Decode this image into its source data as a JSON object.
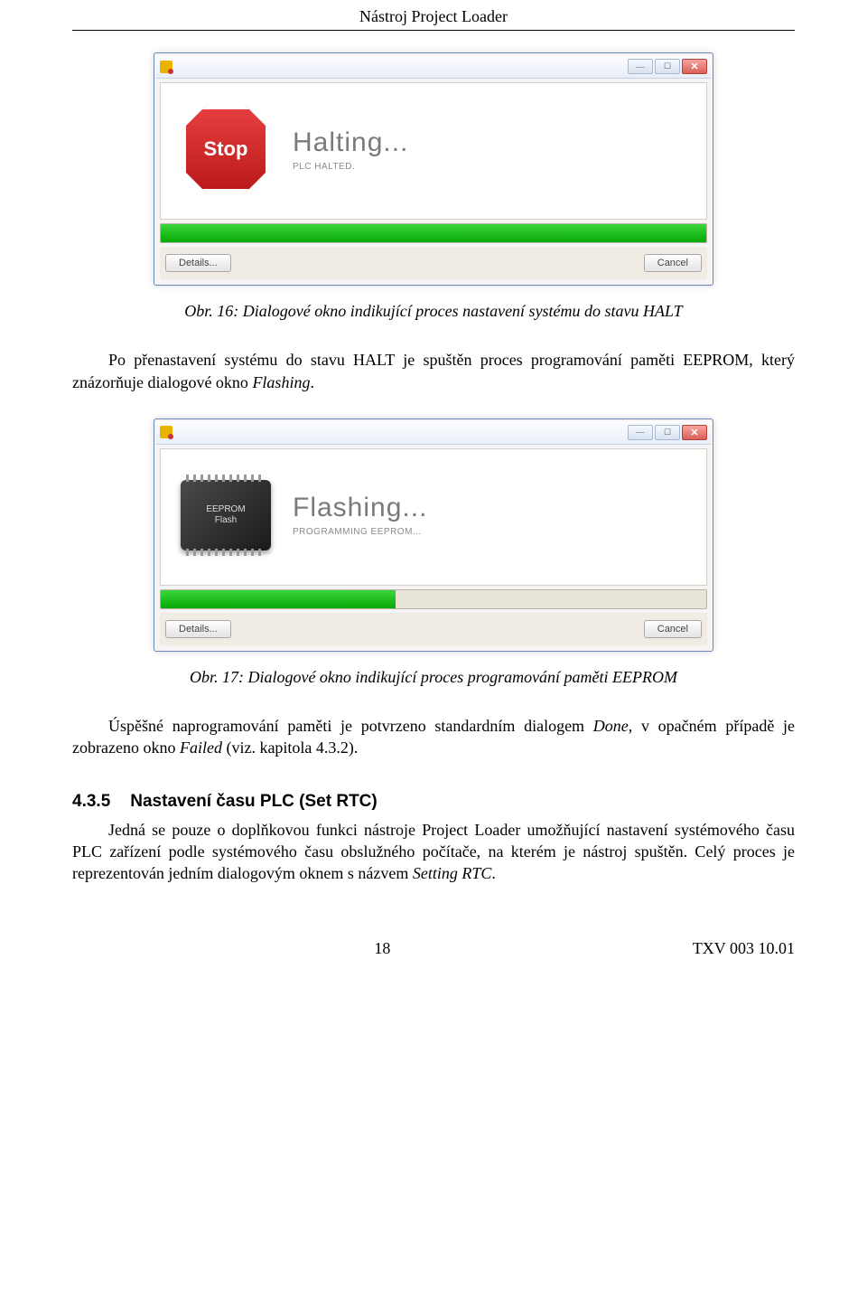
{
  "header": "Nástroj Project Loader",
  "dialog1": {
    "stop_label": "Stop",
    "title": "Halting...",
    "sub": "PLC HALTED.",
    "details": "Details...",
    "cancel": "Cancel",
    "progress_pct": 100
  },
  "caption1": "Obr. 16: Dialogové okno indikující proces nastavení systému do stavu HALT",
  "para1_a": "Po přenastavení systému do stavu HALT je spuštěn proces programování paměti EEPROM, který znázorňuje dialogové okno ",
  "para1_b": "Flashing",
  "para1_c": ".",
  "dialog2": {
    "chip_line1": "EEPROM",
    "chip_line2": "Flash",
    "title": "Flashing...",
    "sub": "PROGRAMMING EEPROM...",
    "details": "Details...",
    "cancel": "Cancel",
    "progress_pct": 43
  },
  "caption2": "Obr. 17: Dialogové okno indikující proces programování paměti EEPROM",
  "para2_a": "Úspěšné naprogramování paměti je potvrzeno standardním dialogem ",
  "para2_b": "Done",
  "para2_c": ", v opačném případě je zobrazeno okno ",
  "para2_d": "Failed",
  "para2_e": " (viz. kapitola 4.3.2).",
  "section": {
    "num": "4.3.5",
    "title": "Nastavení času PLC (Set RTC)"
  },
  "para3_a": "Jedná se pouze o doplňkovou funkci nástroje Project Loader umožňující nastavení systémového času PLC zařízení podle systémového času obslužného počítače, na kterém je nástroj spuštěn. Celý proces je reprezentován jedním dialogovým oknem s názvem ",
  "para3_b": "Setting RTC",
  "para3_c": ".",
  "footer": {
    "page": "18",
    "doc": "TXV 003 10.01"
  }
}
